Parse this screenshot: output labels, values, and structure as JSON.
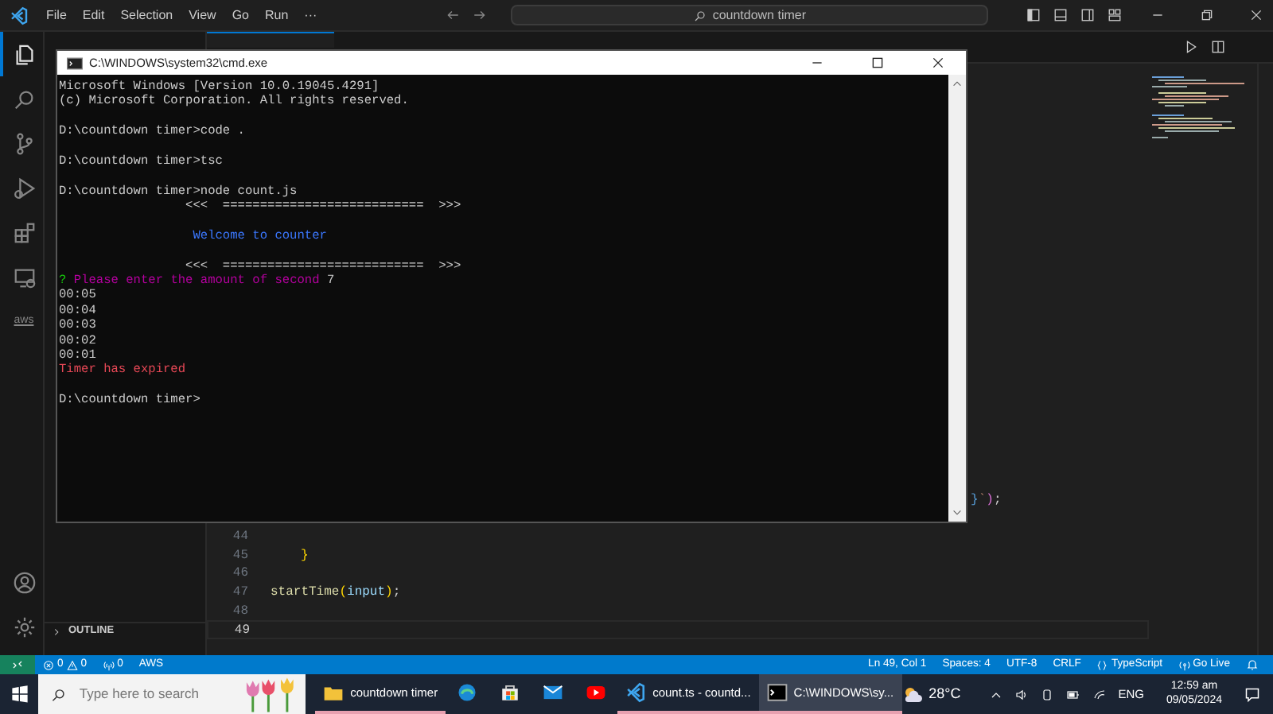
{
  "titlebar": {
    "menu": [
      "File",
      "Edit",
      "Selection",
      "View",
      "Go",
      "Run",
      "···"
    ],
    "search": "countdown timer"
  },
  "activity_bar": {
    "top": [
      {
        "kind": "files",
        "selected": true
      },
      {
        "kind": "search",
        "selected": false
      },
      {
        "kind": "branch",
        "selected": false
      },
      {
        "kind": "run",
        "selected": false
      },
      {
        "kind": "extensions",
        "selected": false
      },
      {
        "kind": "remote",
        "selected": false
      },
      {
        "kind": "aws",
        "label": "aws",
        "selected": false
      }
    ],
    "bottom": [
      {
        "kind": "account",
        "selected": false
      },
      {
        "kind": "settings",
        "selected": false
      }
    ]
  },
  "sidebar": {
    "sections": [
      {
        "label": "OUTLINE",
        "expanded": false
      }
    ]
  },
  "editor": {
    "lines": [
      {
        "tail": true,
        "tokens": [
          {
            "text": "}",
            "kind": "brace"
          },
          {
            "text": "`",
            "kind": "string"
          },
          {
            "text": ")",
            "kind": "paren"
          },
          {
            "text": ";",
            "kind": "plain"
          }
        ]
      },
      {
        "number": "44"
      },
      {
        "number": "45",
        "indent": true,
        "tokens": [
          {
            "text": "}",
            "kind": "bracket"
          }
        ]
      },
      {
        "number": "46"
      },
      {
        "number": "47",
        "tokens": [
          {
            "text": "startTime",
            "kind": "function"
          },
          {
            "text": "(",
            "kind": "bracket"
          },
          {
            "text": "input",
            "kind": "variable"
          },
          {
            "text": ")",
            "kind": "bracket"
          },
          {
            "text": ";",
            "kind": "plain"
          }
        ]
      },
      {
        "number": "48"
      },
      {
        "number": "49",
        "current": true
      }
    ]
  },
  "terminal": {
    "title": "C:\\WINDOWS\\system32\\cmd.exe",
    "lines": [
      {
        "kind": "plain",
        "text": "Microsoft Windows [Version 10.0.19045.4291]"
      },
      {
        "kind": "plain",
        "text": "(c) Microsoft Corporation. All rights reserved."
      },
      {
        "kind": "blank"
      },
      {
        "kind": "plain",
        "text": "D:\\countdown timer>code ."
      },
      {
        "kind": "blank"
      },
      {
        "kind": "plain",
        "text": "D:\\countdown timer>tsc"
      },
      {
        "kind": "blank"
      },
      {
        "kind": "plain",
        "text": "D:\\countdown timer>node count.js"
      },
      {
        "kind": "plain",
        "text": "                 <<<  ===========================  >>>"
      },
      {
        "kind": "blank"
      },
      {
        "kind": "info",
        "text": "                  Welcome to counter"
      },
      {
        "kind": "blank"
      },
      {
        "kind": "plain",
        "text": "                 <<<  ===========================  >>>"
      },
      {
        "kind": "prompt",
        "mark": "?",
        "text": "Please enter the amount of second",
        "answer": "7"
      },
      {
        "kind": "plain",
        "text": "00:05"
      },
      {
        "kind": "plain",
        "text": "00:04"
      },
      {
        "kind": "plain",
        "text": "00:03"
      },
      {
        "kind": "plain",
        "text": "00:02"
      },
      {
        "kind": "plain",
        "text": "00:01"
      },
      {
        "kind": "error",
        "text": "Timer has expired"
      },
      {
        "kind": "blank"
      },
      {
        "kind": "plain",
        "text": "D:\\countdown timer>"
      }
    ]
  },
  "status_bar": {
    "left": [
      {
        "kind": "remote"
      },
      {
        "kind": "problems",
        "errors": "0",
        "warnings": "0"
      },
      {
        "kind": "ports",
        "text": "0"
      },
      {
        "kind": "text",
        "text": "AWS"
      }
    ],
    "right": [
      {
        "kind": "text",
        "text": "Ln 49, Col 1"
      },
      {
        "kind": "text",
        "text": "Spaces: 4"
      },
      {
        "kind": "text",
        "text": "UTF-8"
      },
      {
        "kind": "text",
        "text": "CRLF"
      },
      {
        "kind": "language",
        "text": "TypeScript"
      },
      {
        "kind": "golive",
        "text": "Go Live"
      },
      {
        "kind": "bell"
      }
    ]
  },
  "taskbar": {
    "search_placeholder": "Type here to search",
    "apps": [
      {
        "kind": "folder",
        "label": "countdown timer",
        "running": true,
        "selected": false
      },
      {
        "kind": "edge",
        "running": false,
        "selected": false
      },
      {
        "kind": "store",
        "running": false,
        "selected": false
      },
      {
        "kind": "mail",
        "running": false,
        "selected": false
      },
      {
        "kind": "youtube",
        "running": false,
        "selected": false
      },
      {
        "kind": "vscode",
        "label": "count.ts - countd...",
        "running": true,
        "selected": false
      },
      {
        "kind": "cmd",
        "label": "C:\\WINDOWS\\sy...",
        "running": true,
        "selected": true
      }
    ],
    "weather": "28°C",
    "language": "ENG",
    "time": "12:59 am",
    "date": "09/05/2024"
  }
}
